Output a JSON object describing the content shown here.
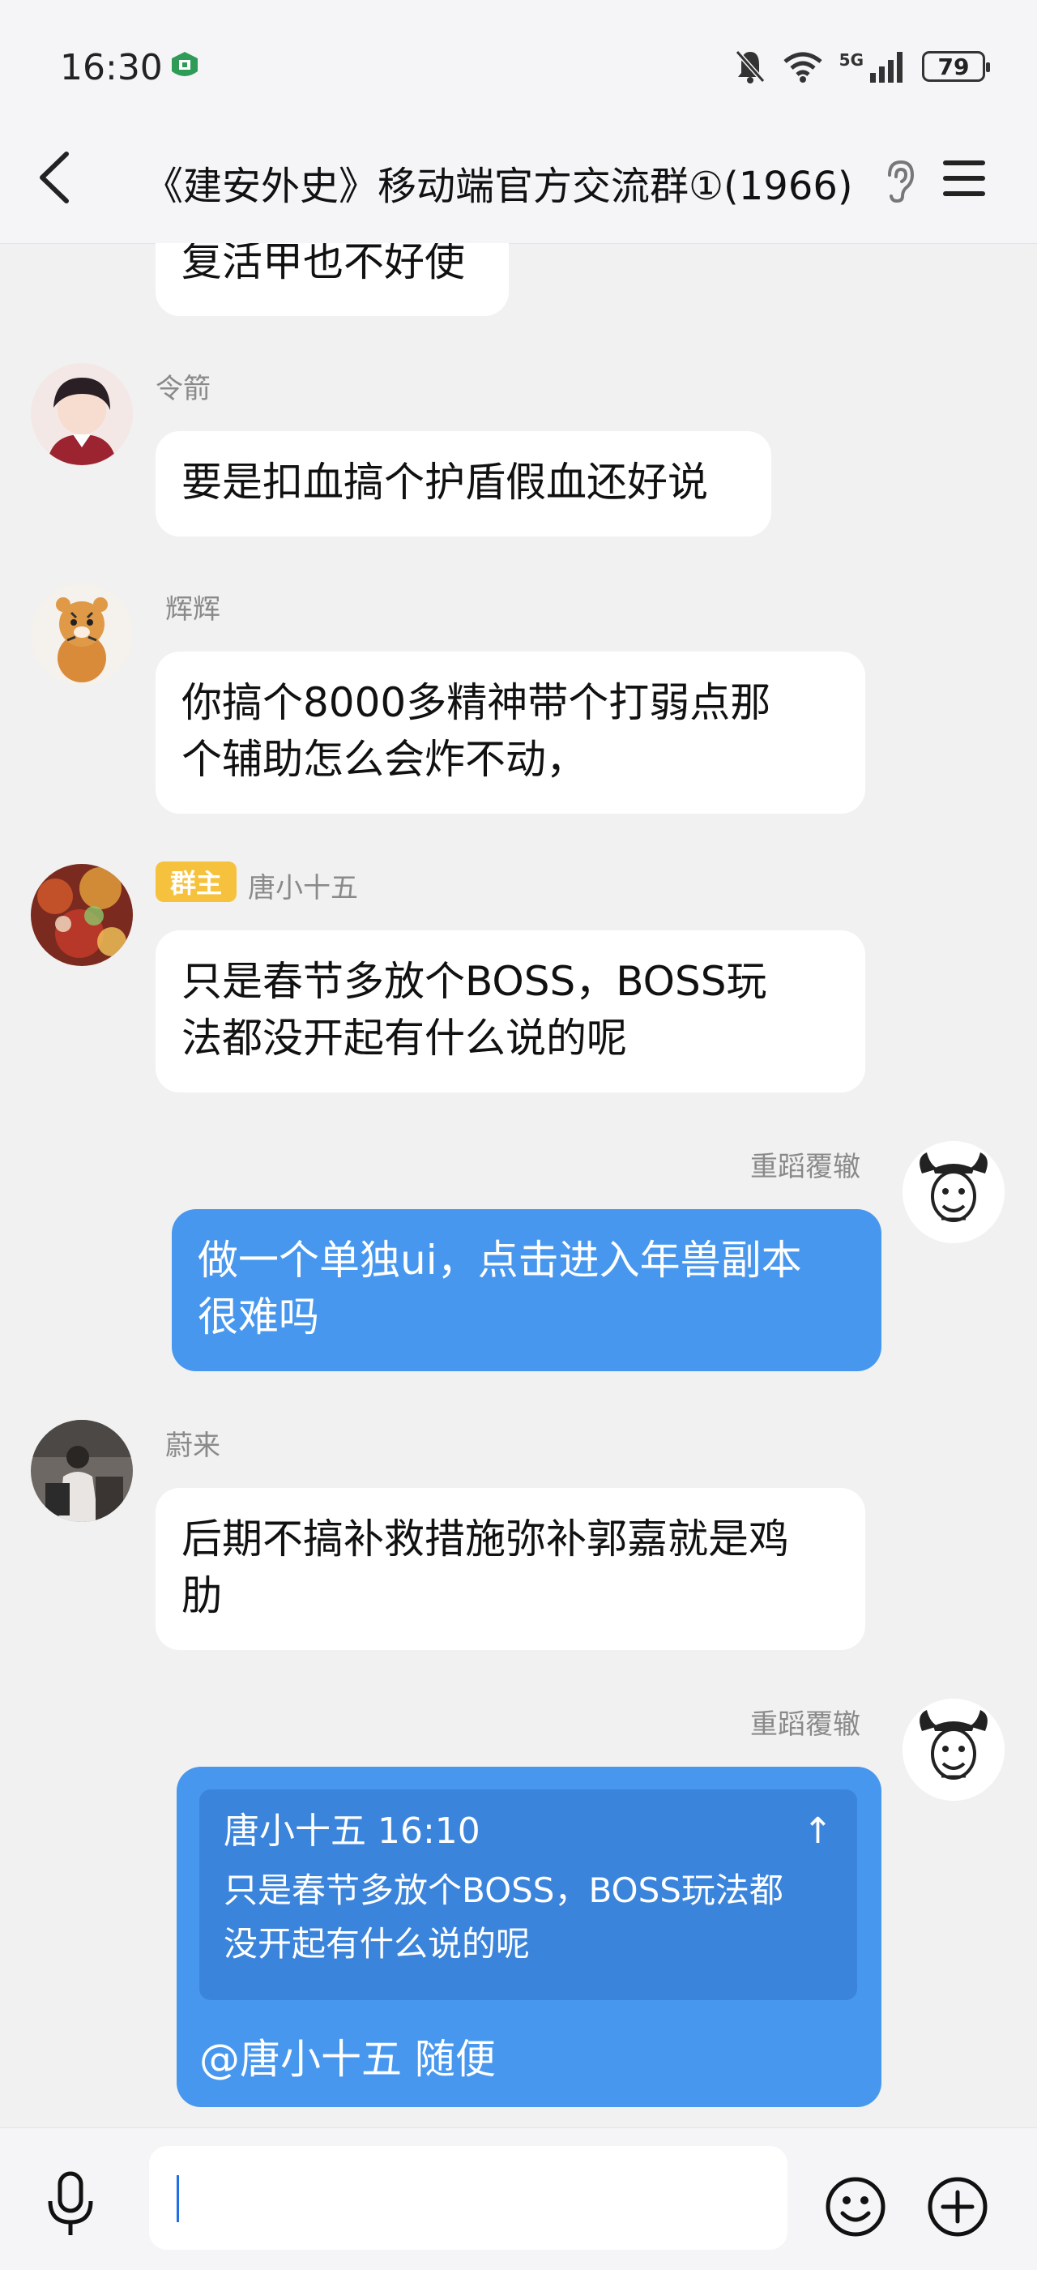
{
  "status_bar": {
    "time": "16:30",
    "network": "5G",
    "battery": "79"
  },
  "header": {
    "title": "《建安外史》移动端官方交流群①(1966)"
  },
  "messages": [
    {
      "text": "复活甲也不好使"
    },
    {
      "sender": "令箭",
      "text": "要是扣血搞个护盾假血还好说"
    },
    {
      "sender": "辉辉",
      "text_lines": [
        "你搞个8000多精神带个打弱点那",
        "个辅助怎么会炸不动，"
      ]
    },
    {
      "badge": "群主",
      "sender": "唐小十五",
      "text_lines": [
        "只是春节多放个BOSS，BOSS玩",
        "法都没开起有什么说的呢"
      ]
    },
    {
      "sender": "重蹈覆辙",
      "text_lines": [
        "做一个单独ui，点击进入年兽副本",
        "很难吗"
      ]
    },
    {
      "sender": "蔚来",
      "text_lines": [
        "后期不搞补救措施弥补郭嘉就是鸡",
        "肋"
      ]
    },
    {
      "sender": "重蹈覆辙",
      "quote": {
        "header": "唐小十五 16:10",
        "arrow": "↑",
        "lines": [
          "只是春节多放个BOSS，BOSS玩法都",
          "没开起有什么说的呢"
        ]
      },
      "text": "@唐小十五 随便"
    }
  ],
  "input": {
    "value": "",
    "placeholder": ""
  },
  "colors": {
    "my_bubble": "#4797ef",
    "quote_bg": "#3b84dc",
    "owner_badge": "#f6c23e"
  }
}
